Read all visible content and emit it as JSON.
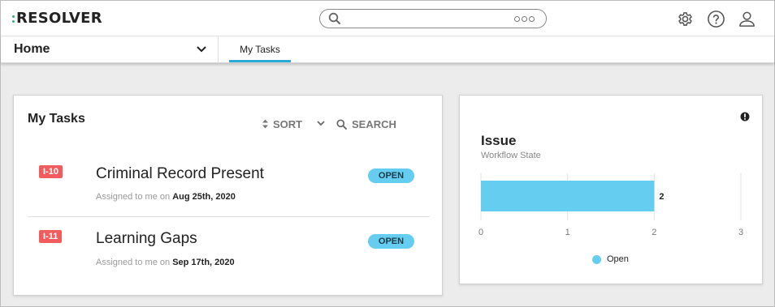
{
  "app": {
    "logo_text": "RESOLVER"
  },
  "search": {
    "value": "",
    "placeholder": ""
  },
  "icons": {
    "search": "search-icon",
    "more": "more-icon",
    "settings": "gear-icon",
    "help": "help-icon",
    "user": "user-icon",
    "chevron": "chevron-down-icon",
    "sort": "sort-icon",
    "alert": "alert-icon"
  },
  "nav": {
    "home_label": "Home",
    "tabs": [
      {
        "label": "My Tasks",
        "active": true
      }
    ]
  },
  "tasks": {
    "title": "My Tasks",
    "sort_label": "SORT",
    "search_label": "SEARCH",
    "assigned_prefix": "Assigned to me on",
    "items": [
      {
        "id": "I-10",
        "name": "Criminal Record Present",
        "date": "Aug 25th, 2020",
        "status": "OPEN"
      },
      {
        "id": "I-11",
        "name": "Learning Gaps",
        "date": "Sep 17th, 2020",
        "status": "OPEN"
      }
    ]
  },
  "issue": {
    "title": "Issue",
    "subtitle": "Workflow State"
  },
  "colors": {
    "accent": "#28a9d6",
    "status_open": "#65cdf0",
    "id_badge": "#f25c5c",
    "logo_dots": "#2bb673"
  },
  "chart_data": {
    "type": "bar",
    "orientation": "horizontal",
    "categories": [
      "Open"
    ],
    "series": [
      {
        "name": "Open",
        "values": [
          2
        ]
      }
    ],
    "data_labels": [
      "2"
    ],
    "x_ticks": [
      "0",
      "1",
      "2",
      "3"
    ],
    "xlim": [
      0,
      3
    ],
    "grid": true,
    "legend": "bottom",
    "title": "",
    "xlabel": "",
    "ylabel": ""
  }
}
